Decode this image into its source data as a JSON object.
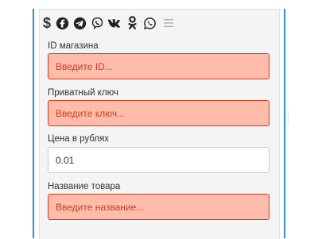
{
  "toolbar": {
    "icons": [
      "dollar-icon",
      "facebook-icon",
      "telegram-icon",
      "viber-icon",
      "vk-icon",
      "odnoklassniki-icon",
      "whatsapp-icon",
      "menu-icon"
    ],
    "dollar_glyph": "$"
  },
  "form": {
    "shop_id_label": "ID магазина",
    "shop_id_placeholder": "Введите ID...",
    "private_key_label": "Приватный ключ",
    "private_key_placeholder": "Введите ключ...",
    "price_label": "Цена в рублях",
    "price_value": "0.01",
    "product_name_label": "Название товара",
    "product_name_placeholder": "Введите название..."
  },
  "colors": {
    "error_bg": "#ffbcaa",
    "error_border": "#d23c1c",
    "accent": "#2f8fd6"
  }
}
